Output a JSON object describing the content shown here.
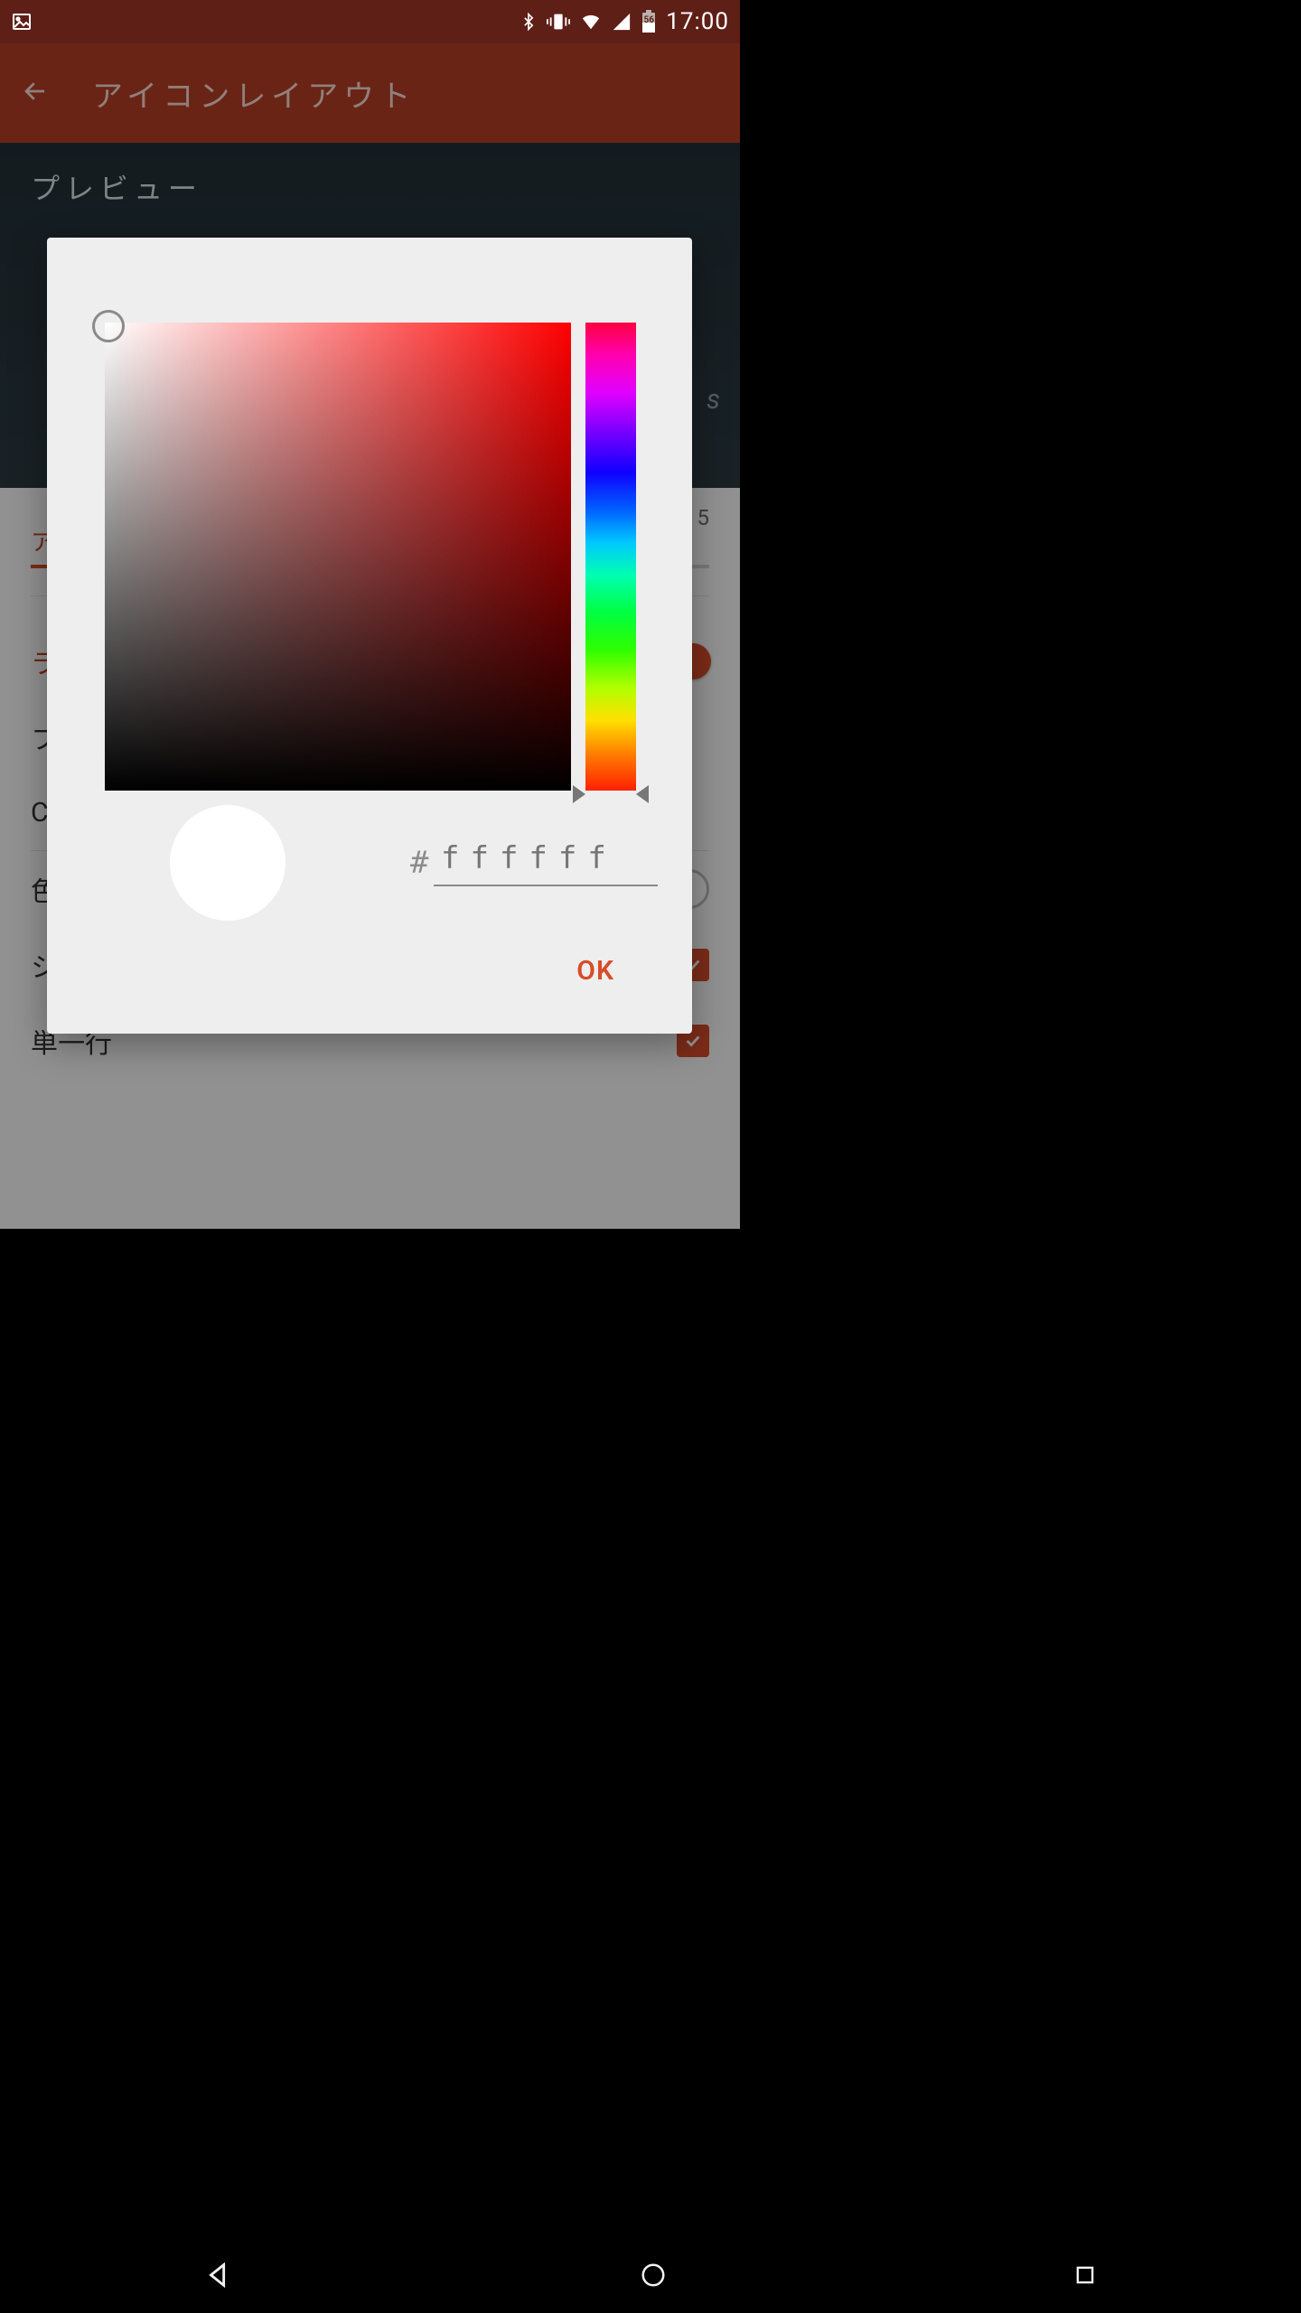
{
  "status": {
    "time": "17:00",
    "battery_badge": "56"
  },
  "appbar": {
    "title": "アイコンレイアウト"
  },
  "preview": {
    "label": "プレビュー",
    "hint_suffix": "s"
  },
  "sections": {
    "icon_size_letter": "ア",
    "size_value": "5",
    "label_section_letter": "ラ",
    "font_row_first": "フ",
    "condensed_row_first": "C",
    "color_label": "色",
    "shadow_label": "シャドウ",
    "single_line_label": "単一行"
  },
  "toggles": {
    "label_toggle": true,
    "shadow_checked": true,
    "single_line_checked": true
  },
  "dialog": {
    "hash": "#",
    "hex_value": "ffffff",
    "ok_label": "OK",
    "selected_color": "#ffffff"
  }
}
